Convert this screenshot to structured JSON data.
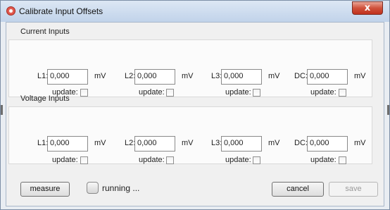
{
  "window": {
    "title": "Calibrate Input Offsets",
    "close_label": "x"
  },
  "current": {
    "group_title": "Current Inputs",
    "rows": [
      {
        "label": "L1:",
        "value": "0,000",
        "unit": "mV",
        "update_label": "update:",
        "update_checked": false
      },
      {
        "label": "L2:",
        "value": "0,000",
        "unit": "mV",
        "update_label": "update:",
        "update_checked": false
      },
      {
        "label": "L3:",
        "value": "0,000",
        "unit": "mV",
        "update_label": "update:",
        "update_checked": false
      },
      {
        "label": "DC:",
        "value": "0,000",
        "unit": "mV",
        "update_label": "update:",
        "update_checked": false
      }
    ]
  },
  "voltage": {
    "group_title": "Voltage Inputs",
    "rows": [
      {
        "label": "L1:",
        "value": "0,000",
        "unit": "mV",
        "update_label": "update:",
        "update_checked": false
      },
      {
        "label": "L2:",
        "value": "0,000",
        "unit": "mV",
        "update_label": "update:",
        "update_checked": false
      },
      {
        "label": "L3:",
        "value": "0,000",
        "unit": "mV",
        "update_label": "update:",
        "update_checked": false
      },
      {
        "label": "DC:",
        "value": "0,000",
        "unit": "mV",
        "update_label": "update:",
        "update_checked": false
      }
    ]
  },
  "footer": {
    "measure_label": "measure",
    "running_label": "running ...",
    "cancel_label": "cancel",
    "save_label": "save"
  }
}
